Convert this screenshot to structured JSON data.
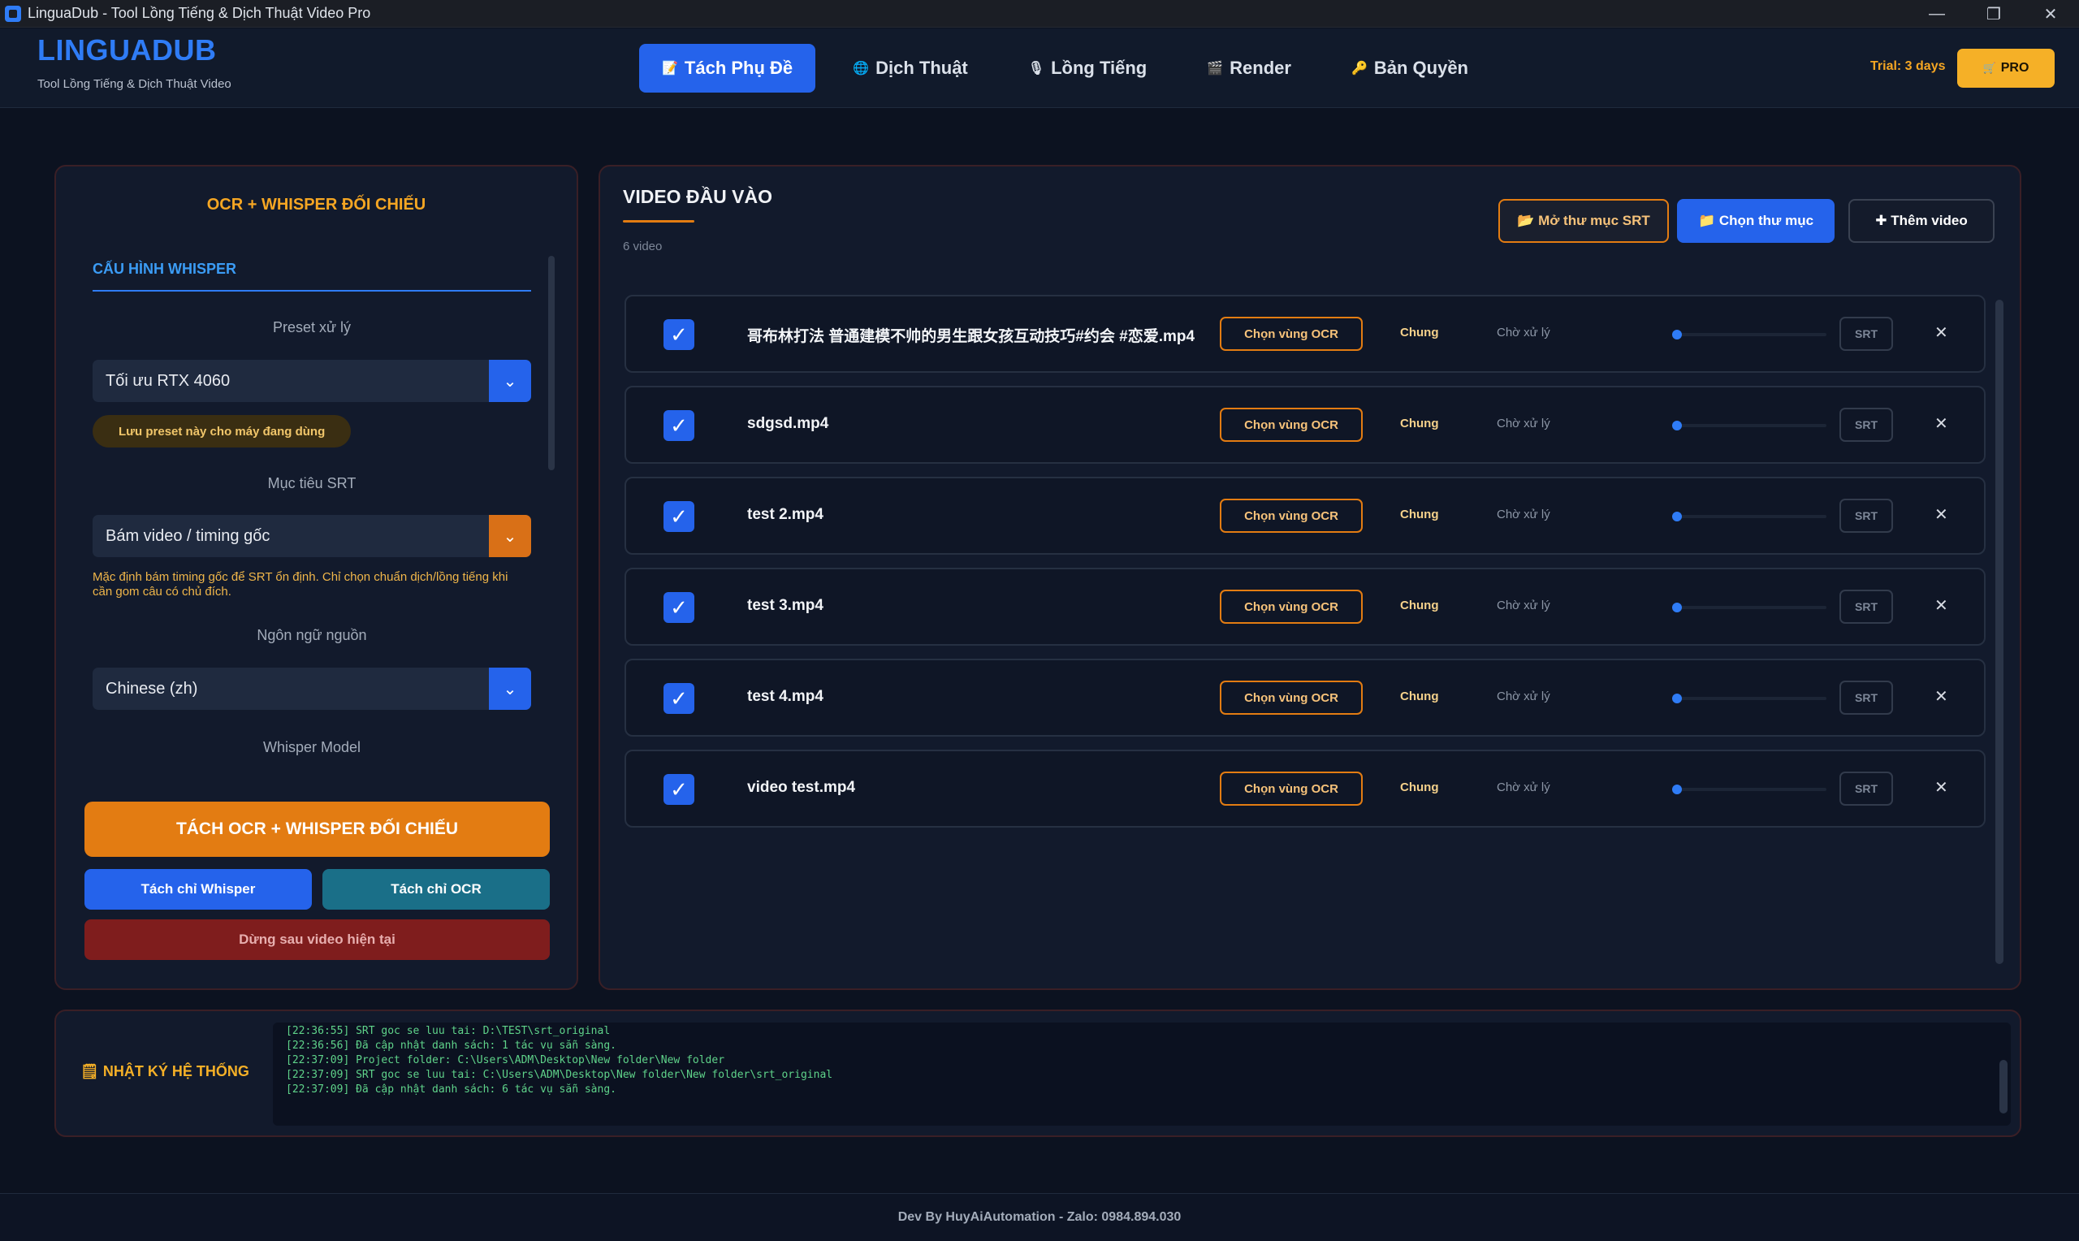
{
  "window": {
    "title": "LinguaDub - Tool Lồng Tiếng & Dịch Thuật Video Pro",
    "controls": [
      "—",
      "❐",
      "✕"
    ]
  },
  "header": {
    "brand": "LINGUADUB",
    "tagline": "Tool Lồng Tiếng & Dịch Thuật Video",
    "nav": [
      {
        "label": "Tách Phụ Đề",
        "icon": "📝"
      },
      {
        "label": "Dịch Thuật",
        "icon": "🌐"
      },
      {
        "label": "Lồng Tiếng",
        "icon": "🎙"
      },
      {
        "label": "Render",
        "icon": "🎬"
      },
      {
        "label": "Bản Quyền",
        "icon": "🔑"
      }
    ],
    "trial": "Trial: 3 days",
    "pro_label": "PRO"
  },
  "left": {
    "title": "OCR + WHISPER ĐỐI CHIẾU",
    "section": "CẤU HÌNH WHISPER",
    "preset_label": "Preset xử lý",
    "preset_value": "Tối ưu RTX 4060",
    "save_preset": "Lưu preset này cho máy đang dùng",
    "target_label": "Mục tiêu SRT",
    "target_value": "Bám video / timing gốc",
    "hint": "Mặc định bám timing gốc để SRT ổn định. Chỉ chọn chuẩn dịch/lồng tiếng khi cần gom câu có chủ đích.",
    "lang_label": "Ngôn ngữ nguồn",
    "lang_value": "Chinese (zh)",
    "model_label": "Whisper Model",
    "main_button": "TÁCH OCR + WHISPER ĐỐI CHIẾU",
    "whisper_only": "Tách chỉ Whisper",
    "ocr_only": "Tách chỉ OCR",
    "stop": "Dừng sau video hiện tại"
  },
  "right": {
    "title": "VIDEO ĐẦU VÀO",
    "count": "6 video",
    "open_srt": "📂 Mở thư mục SRT",
    "choose_folder": "📁 Chọn thư mục",
    "add_video": "✚ Thêm video",
    "rows": [
      {
        "name": "哥布林打法 普通建模不帅的男生跟女孩互动技巧#约会 #恋爱.mp4",
        "ocr": "Chọn vùng OCR",
        "mode": "Chung",
        "status": "Chờ xử lý",
        "srt": "SRT",
        "progress": 0
      },
      {
        "name": "sdgsd.mp4",
        "ocr": "Chọn vùng OCR",
        "mode": "Chung",
        "status": "Chờ xử lý",
        "srt": "SRT",
        "progress": 0
      },
      {
        "name": "test 2.mp4",
        "ocr": "Chọn vùng OCR",
        "mode": "Chung",
        "status": "Chờ xử lý",
        "srt": "SRT",
        "progress": 0
      },
      {
        "name": "test 3.mp4",
        "ocr": "Chọn vùng OCR",
        "mode": "Chung",
        "status": "Chờ xử lý",
        "srt": "SRT",
        "progress": 0
      },
      {
        "name": "test 4.mp4",
        "ocr": "Chọn vùng OCR",
        "mode": "Chung",
        "status": "Chờ xử lý",
        "srt": "SRT",
        "progress": 0
      },
      {
        "name": "video test.mp4",
        "ocr": "Chọn vùng OCR",
        "mode": "Chung",
        "status": "Chờ xử lý",
        "srt": "SRT",
        "progress": 0
      }
    ]
  },
  "log": {
    "title": "NHẬT KÝ HỆ THỐNG",
    "lines": [
      "[22:36:55] SRT goc se luu tai: D:\\TEST\\srt_original",
      "[22:36:56] Đã cập nhật danh sách: 1 tác vụ sẵn sàng.",
      "[22:37:09] Project folder: C:\\Users\\ADM\\Desktop\\New folder\\New folder",
      "[22:37:09] SRT goc se luu tai: C:\\Users\\ADM\\Desktop\\New folder\\New folder\\srt_original",
      "[22:37:09] Đã cập nhật danh sách: 6 tác vụ sẵn sàng."
    ]
  },
  "footer": "Dev By HuyAiAutomation - Zalo: 0984.894.030",
  "colors": {
    "accent": "#2563eb",
    "orange": "#e37c12",
    "gold": "#f5b027",
    "danger": "#7f1d1d"
  }
}
